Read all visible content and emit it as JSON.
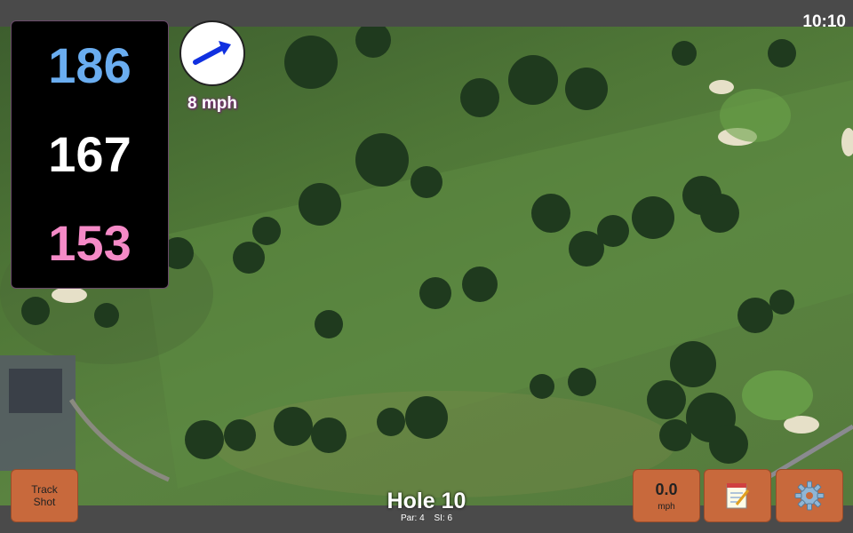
{
  "status": {
    "time": "10:10"
  },
  "yardage": {
    "back": "186",
    "middle": "167",
    "front": "153"
  },
  "wind": {
    "speed_label": "8 mph",
    "arrow_icon": "arrow-up-right-icon"
  },
  "buttons": {
    "track_shot_line1": "Track",
    "track_shot_line2": "Shot",
    "speed_value": "0.0",
    "speed_unit": "mph",
    "notes_icon": "notepad-icon",
    "settings_icon": "gear-icon"
  },
  "hole": {
    "title": "Hole 10",
    "par": "Par: 4",
    "si": "SI: 6"
  },
  "colors": {
    "back": "#6aadf0",
    "middle": "#ffffff",
    "front": "#f58ac7",
    "button": "#c8693c"
  }
}
